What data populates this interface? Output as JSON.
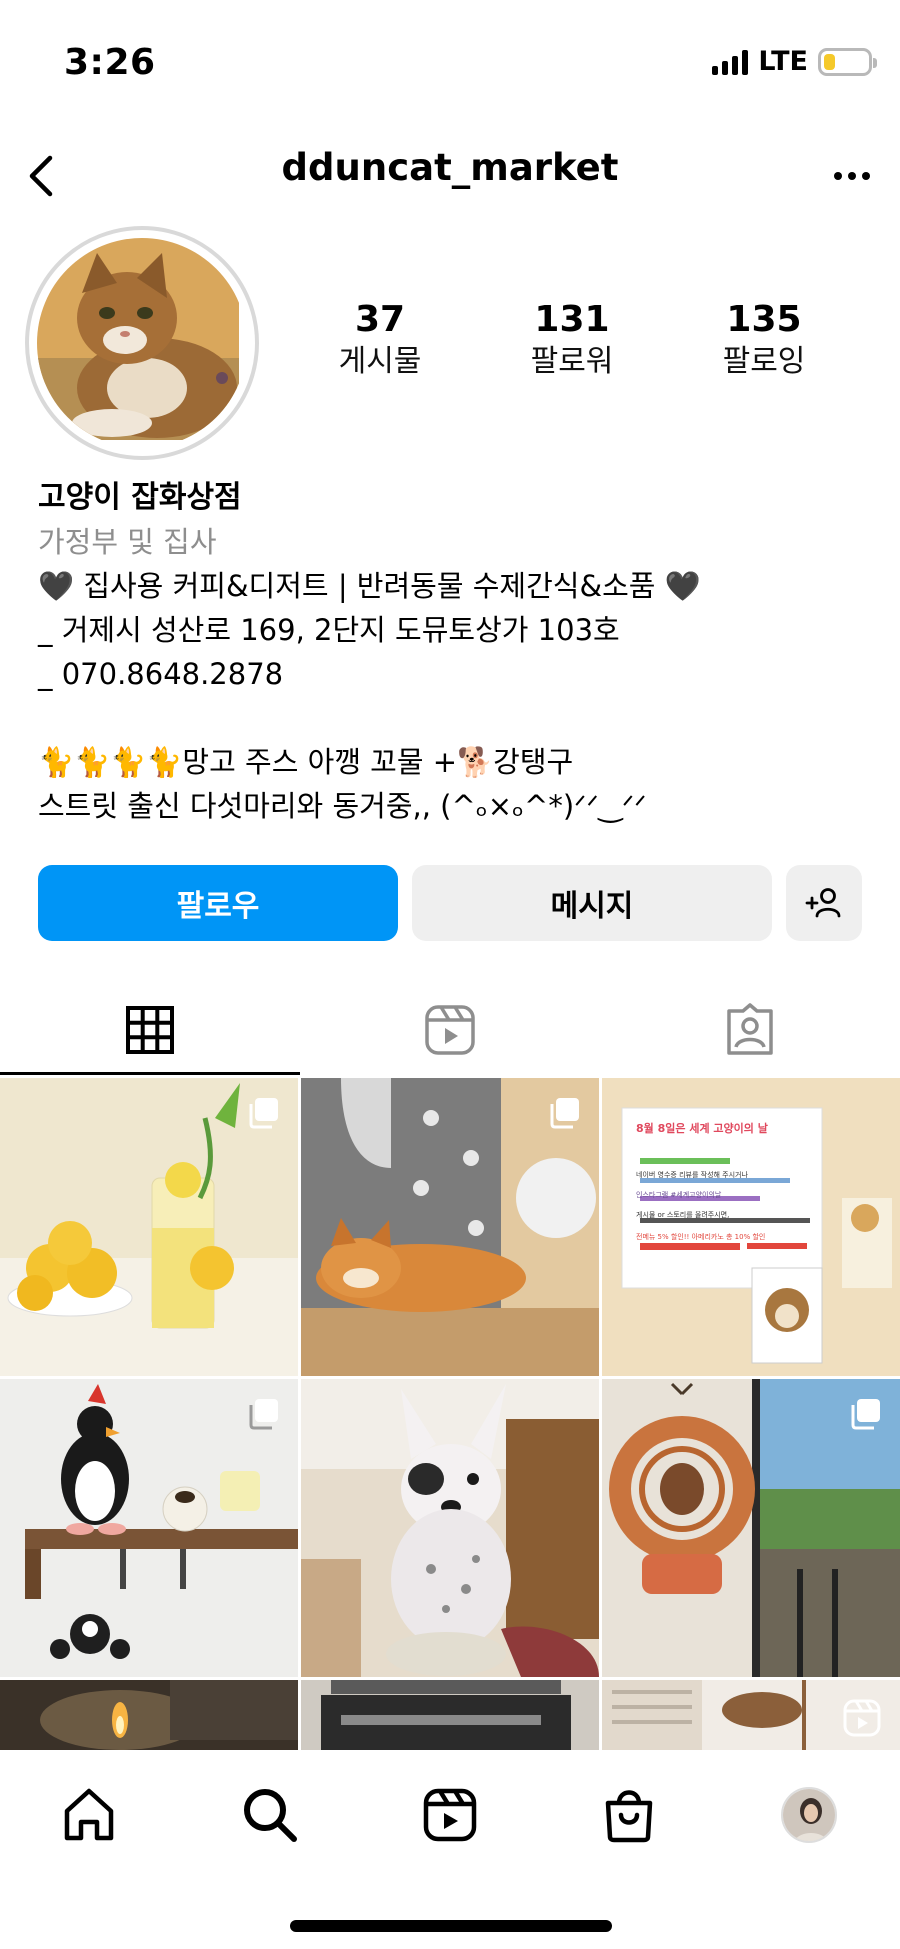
{
  "status_bar": {
    "time": "3:26",
    "network": "LTE",
    "battery_level": 0.25,
    "battery_color": "#f5c92a"
  },
  "header": {
    "username": "dduncat_market",
    "back_icon": "chevron-left-icon",
    "more_icon": "ellipsis-icon"
  },
  "profile": {
    "stats": [
      {
        "value": "37",
        "label": "게시물"
      },
      {
        "value": "131",
        "label": "팔로워"
      },
      {
        "value": "135",
        "label": "팔로잉"
      }
    ],
    "name": "고양이 잡화상점",
    "category": "가정부 및 집사",
    "bio_lines": [
      "🖤 집사용 커피&디저트 | 반려동물 수제간식&소품 🖤",
      "_ 거제시 성산로 169, 2단지 도뮤토상가 103호",
      "_ 070.8648.2878",
      "🐈🐈🐈🐈망고 주스 아깽 꼬물 +🐕강탱구",
      "스트릿 출신 다섯마리와 동거중,, (^ₒ×ₒ^*)ᐟᐟ‿ᐟᐟ"
    ]
  },
  "actions": {
    "follow_label": "팔로우",
    "message_label": "메시지",
    "add_user_icon": "add-user-icon",
    "follow_color": "#0095f6"
  },
  "tabs": [
    {
      "icon": "grid-icon",
      "active": true
    },
    {
      "icon": "reels-icon",
      "active": false
    },
    {
      "icon": "tagged-icon",
      "active": false
    }
  ],
  "grid_posts": [
    {
      "subject": "lemons-and-lemonade",
      "badge": "multi-photo-icon"
    },
    {
      "subject": "cat-sleeping-on-cat-tree",
      "badge": "multi-photo-icon"
    },
    {
      "subject": "world-cat-day-notice",
      "badge": ""
    },
    {
      "subject": "penguin-plush-on-shelf",
      "badge": "multi-photo-icon"
    },
    {
      "subject": "small-dog-sitting",
      "badge": ""
    },
    {
      "subject": "bread-wreath-by-window",
      "badge": "multi-photo-icon"
    },
    {
      "subject": "candle",
      "badge": ""
    },
    {
      "subject": "espresso-machine",
      "badge": ""
    },
    {
      "subject": "interior-with-chair",
      "badge": "reels-icon"
    }
  ],
  "notice_card": {
    "heading": "8월 8일은 세계 고양이의 날",
    "lines": [
      "네이버 영수증 리뷰를 작성해 주시거나",
      "인스타그램 #세계고양이의날",
      "게시물 or 스토리를 올려주시면,",
      "전메뉴 5% 할인!! 아메리카노 총 10% 할인"
    ]
  },
  "bottom_nav": [
    {
      "icon": "home-icon"
    },
    {
      "icon": "search-icon"
    },
    {
      "icon": "reels-icon"
    },
    {
      "icon": "shop-bag-icon"
    },
    {
      "icon": "profile-avatar"
    }
  ]
}
